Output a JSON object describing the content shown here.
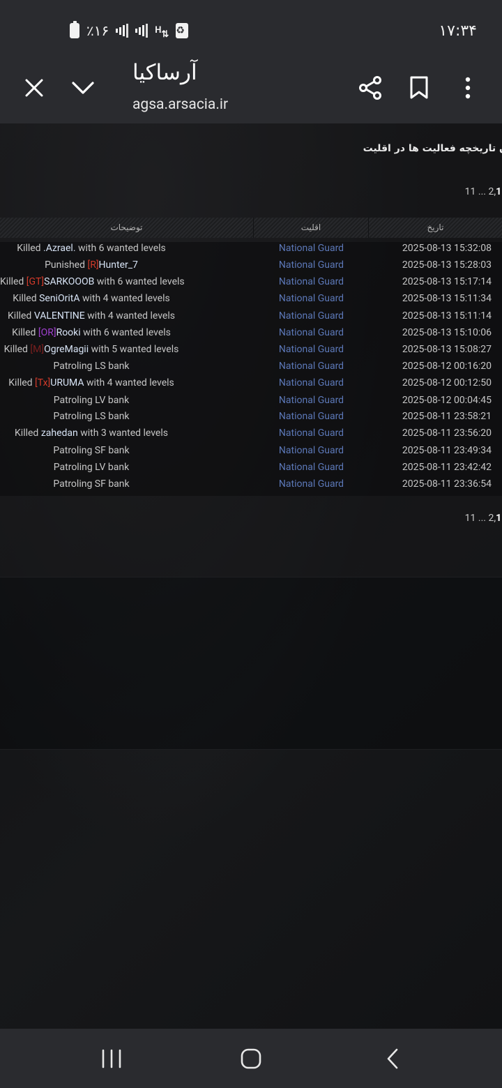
{
  "status_bar": {
    "time": "۱۷:۳۴",
    "battery": "٪۱۶",
    "network": "H"
  },
  "browser": {
    "page_title": "آرساکیا",
    "url": "agsa.arsacia.ir"
  },
  "page": {
    "heading": "ن تاریخچه فعالیت ها در اقلیت",
    "pagination": {
      "last": "11",
      "ellipsis": "...",
      "page2": "2",
      "current": "1",
      "colon": ":"
    },
    "columns": {
      "description": "توضیحات",
      "faction": "اقلیت",
      "date": "تاریخ"
    },
    "rows": [
      {
        "pre": "Killed ",
        "tag": "",
        "name": ".Azrael.",
        "post": " with 6 wanted levels",
        "faction": "National Guard",
        "date": "2025-08-13 15:32:08"
      },
      {
        "pre": "Punished ",
        "tag": "[R]",
        "name": "Hunter_7",
        "post": "",
        "faction": "National Guard",
        "date": "2025-08-13 15:28:03"
      },
      {
        "pre": "Killed ",
        "tag": "[GT]",
        "name": "SARKOOOB",
        "post": " with 6 wanted levels",
        "faction": "National Guard",
        "date": "2025-08-13 15:17:14"
      },
      {
        "pre": "Killed ",
        "tag": "",
        "name": "SeniOritA",
        "post": " with 4 wanted levels",
        "faction": "National Guard",
        "date": "2025-08-13 15:11:34"
      },
      {
        "pre": "Killed ",
        "tag": "",
        "name": "VALENTINE",
        "post": " with 4 wanted levels",
        "faction": "National Guard",
        "date": "2025-08-13 15:11:14"
      },
      {
        "pre": "Killed ",
        "tag": "[OR]",
        "name": "Rooki",
        "post": " with 6 wanted levels",
        "faction": "National Guard",
        "date": "2025-08-13 15:10:06"
      },
      {
        "pre": "Killed ",
        "tag": "[M]",
        "name": "OgreMagii",
        "post": " with 5 wanted levels",
        "faction": "National Guard",
        "date": "2025-08-13 15:08:27"
      },
      {
        "pre": "Patroling LS bank",
        "tag": "",
        "name": "",
        "post": "",
        "faction": "National Guard",
        "date": "2025-08-12 00:16:20"
      },
      {
        "pre": "Killed ",
        "tag": "[Tx]",
        "name": "URUMA",
        "post": " with 4 wanted levels",
        "faction": "National Guard",
        "date": "2025-08-12 00:12:50"
      },
      {
        "pre": "Patroling LV bank",
        "tag": "",
        "name": "",
        "post": "",
        "faction": "National Guard",
        "date": "2025-08-12 00:04:45"
      },
      {
        "pre": "Patroling LS bank",
        "tag": "",
        "name": "",
        "post": "",
        "faction": "National Guard",
        "date": "2025-08-11 23:58:21"
      },
      {
        "pre": "Killed ",
        "tag": "",
        "name": "zahedan",
        "post": " with 3 wanted levels",
        "faction": "National Guard",
        "date": "2025-08-11 23:56:20"
      },
      {
        "pre": "Patroling SF bank",
        "tag": "",
        "name": "",
        "post": "",
        "faction": "National Guard",
        "date": "2025-08-11 23:49:34"
      },
      {
        "pre": "Patroling LV bank",
        "tag": "",
        "name": "",
        "post": "",
        "faction": "National Guard",
        "date": "2025-08-11 23:42:42"
      },
      {
        "pre": "Patroling SF bank",
        "tag": "",
        "name": "",
        "post": "",
        "faction": "National Guard",
        "date": "2025-08-11 23:36:54"
      }
    ]
  },
  "colors": {
    "toolbar_bg": "#2a2b2f",
    "faction_link": "#5c78b8",
    "tag_red": "#d23a2a",
    "tag_dark_red": "#7a1f1f",
    "tag_purple": "#a040d0",
    "player_name": "#d8e4f6"
  },
  "icons": {
    "close": "close-icon",
    "collapse": "chevron-down-icon",
    "share": "share-icon",
    "bookmark": "bookmark-icon",
    "menu": "more-vert-icon",
    "recents": "recents-icon",
    "home": "home-icon",
    "back": "back-icon"
  }
}
